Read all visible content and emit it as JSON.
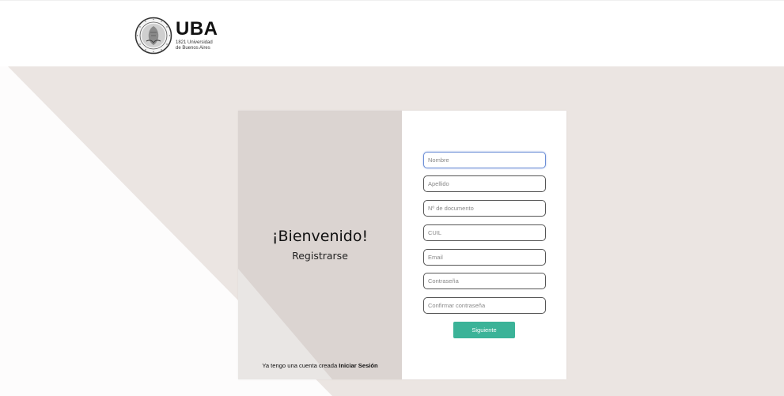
{
  "logo": {
    "title": "UBA",
    "sub_line1": "1821 Universidad",
    "sub_line2": "de Buenos Aires",
    "seal_icon": "university-seal-icon"
  },
  "welcome": {
    "title": "¡Bienvenido!",
    "subtitle": "Registrarse"
  },
  "login_prompt": {
    "text": "Ya tengo una cuenta creada",
    "link": "Iniciar Sesión"
  },
  "form": {
    "fields": [
      {
        "placeholder": "Nombre",
        "value": ""
      },
      {
        "placeholder": "Apellido",
        "value": ""
      },
      {
        "placeholder": "Nº de documento",
        "value": ""
      },
      {
        "placeholder": "CUIL",
        "value": ""
      },
      {
        "placeholder": "Email",
        "value": ""
      },
      {
        "placeholder": "Contraseña",
        "value": ""
      },
      {
        "placeholder": "Confirmar contraseña",
        "value": ""
      }
    ],
    "submit_label": "Siguiente"
  },
  "colors": {
    "background": "#ebe5e2",
    "panel_left": "#dbd4d1",
    "accent": "#3bb398",
    "focus_border": "#6b8ed6"
  }
}
